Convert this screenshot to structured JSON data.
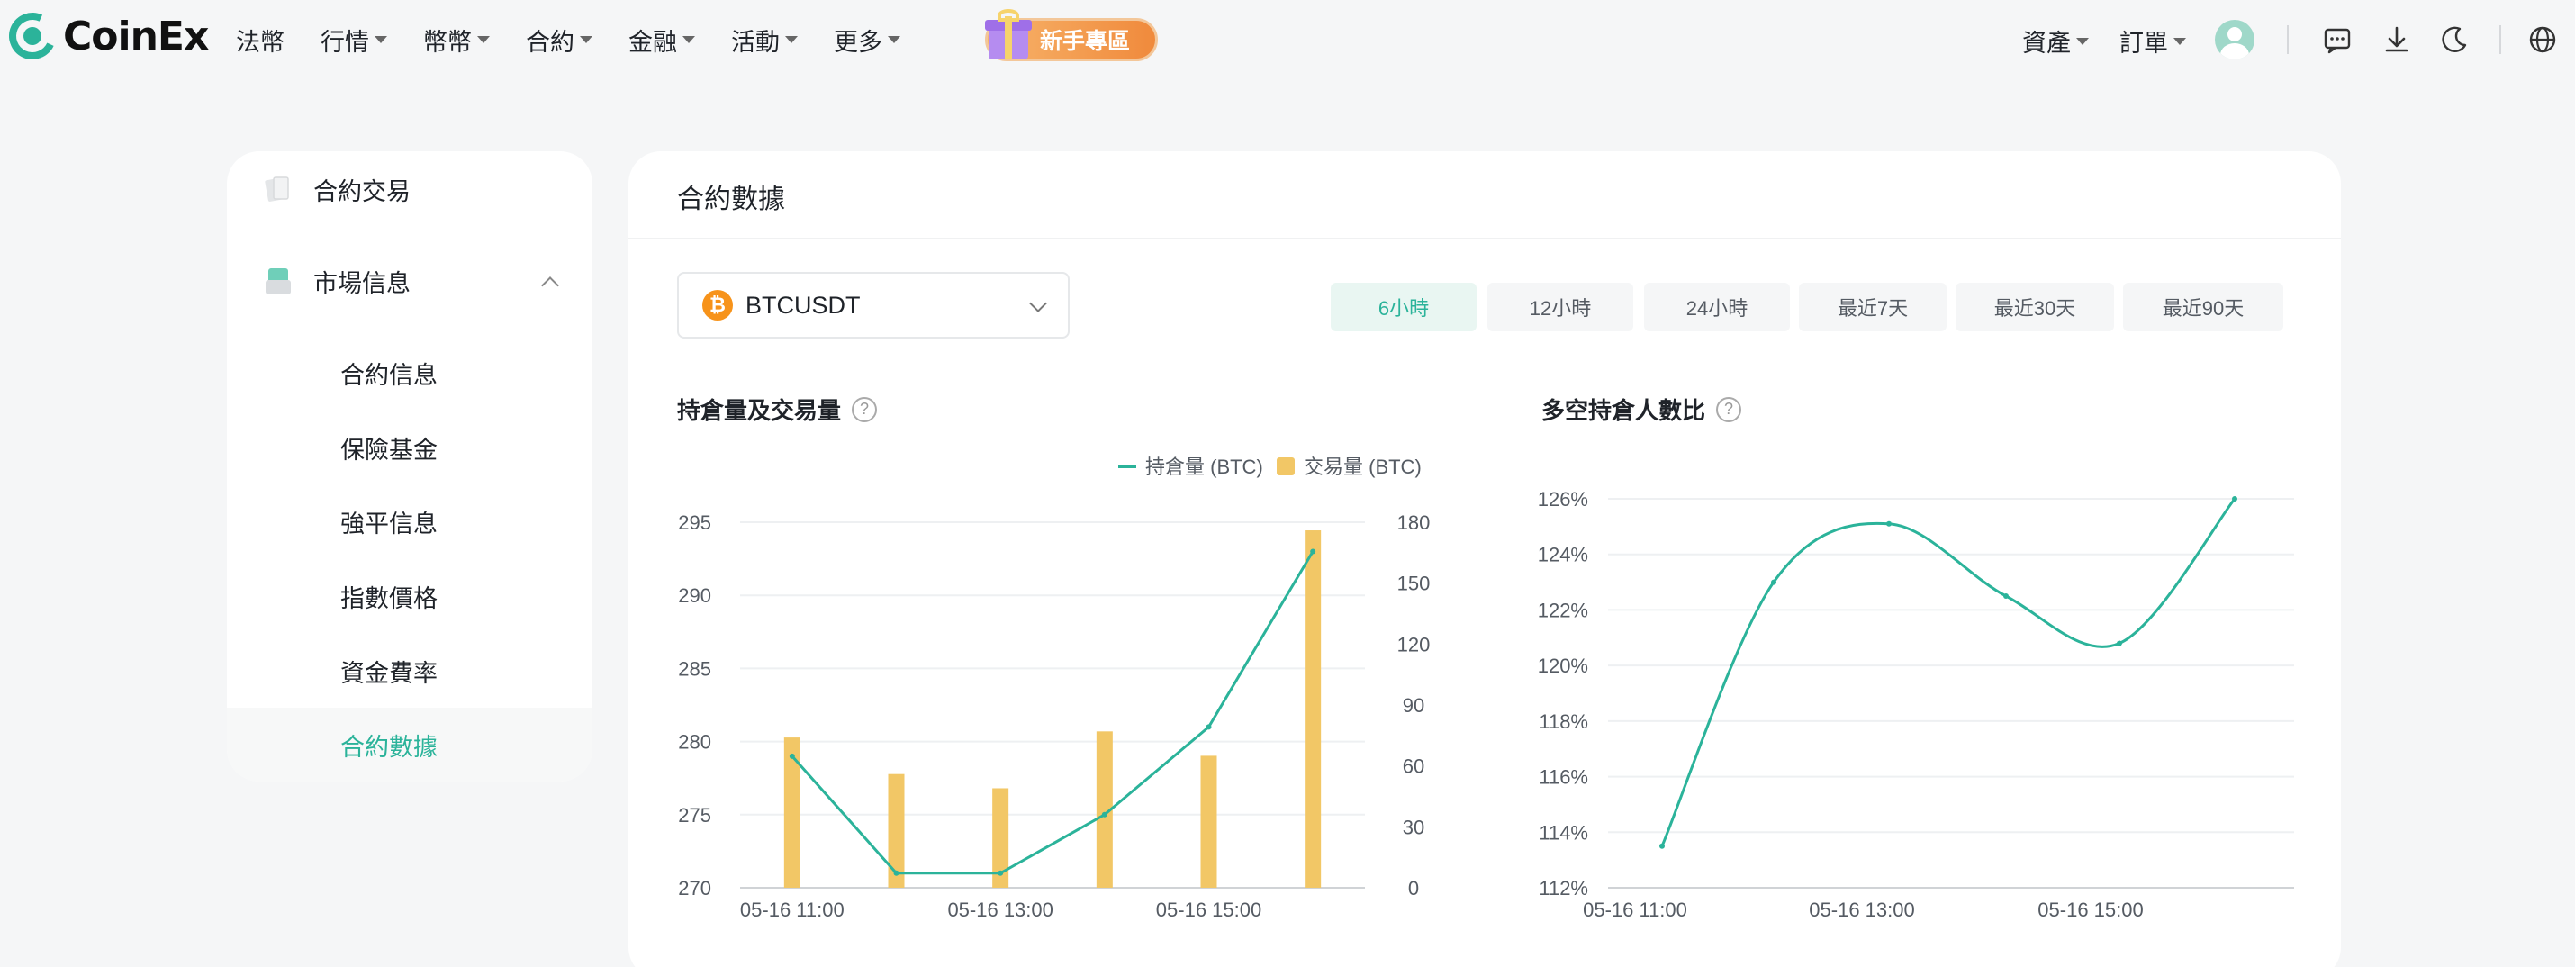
{
  "brand": {
    "name": "CoinEx"
  },
  "nav": {
    "items": [
      {
        "label": "法幣",
        "caret": false
      },
      {
        "label": "行情",
        "caret": true
      },
      {
        "label": "幣幣",
        "caret": true
      },
      {
        "label": "合約",
        "caret": true
      },
      {
        "label": "金融",
        "caret": true
      },
      {
        "label": "活動",
        "caret": true
      },
      {
        "label": "更多",
        "caret": true
      }
    ],
    "promo": "新手專區",
    "assets": "資產",
    "orders": "訂單"
  },
  "sidebar": {
    "sections": [
      {
        "label": "合約交易",
        "icon": "cards-icon"
      },
      {
        "label": "市場信息",
        "icon": "market-icon",
        "expanded": true
      }
    ],
    "items": [
      {
        "label": "合約信息"
      },
      {
        "label": "保險基金"
      },
      {
        "label": "強平信息"
      },
      {
        "label": "指數價格"
      },
      {
        "label": "資金費率"
      },
      {
        "label": "合約數據",
        "active": true
      }
    ]
  },
  "main": {
    "title": "合約數據",
    "pair": {
      "symbol": "BTCUSDT",
      "coin": "₿"
    },
    "ranges": [
      {
        "label": "6小時",
        "active": true
      },
      {
        "label": "12小時"
      },
      {
        "label": "24小時"
      },
      {
        "label": "最近7天"
      },
      {
        "label": "最近30天"
      },
      {
        "label": "最近90天"
      }
    ],
    "panel_left_title": "持倉量及交易量",
    "panel_right_title": "多空持倉人數比",
    "help": "?"
  },
  "colors": {
    "accent": "#2bb39a",
    "bar": "#f2c766",
    "promo": "#f08a3c"
  },
  "chart_data": [
    {
      "type": "bar+line",
      "title": "持倉量及交易量",
      "x_tick_labels": [
        "05-16  11:00",
        "05-16  13:00",
        "05-16  15:00"
      ],
      "legend": [
        "持倉量 (BTC)",
        "交易量 (BTC)"
      ],
      "left_axis": {
        "ticks": [
          270,
          275,
          280,
          285,
          290,
          295
        ],
        "range": [
          270,
          295
        ]
      },
      "right_axis": {
        "ticks": [
          0,
          30,
          60,
          90,
          120,
          150,
          180
        ],
        "range": [
          0,
          180
        ]
      },
      "series": [
        {
          "name": "持倉量 (BTC)",
          "kind": "line",
          "axis": "left",
          "values": [
            279,
            271,
            271,
            275,
            281,
            293
          ]
        },
        {
          "name": "交易量 (BTC)",
          "kind": "bar",
          "axis": "right",
          "values": [
            74,
            56,
            49,
            77,
            65,
            176
          ]
        }
      ]
    },
    {
      "type": "line",
      "title": "多空持倉人數比",
      "x_tick_labels": [
        "05-16  11:00",
        "05-16  13:00",
        "05-16  15:00"
      ],
      "y_axis": {
        "ticks": [
          "112%",
          "114%",
          "116%",
          "118%",
          "120%",
          "122%",
          "124%",
          "126%"
        ],
        "range": [
          112,
          126
        ]
      },
      "series": [
        {
          "name": "多空持倉人數比",
          "values": [
            113.5,
            123.0,
            125.1,
            122.5,
            120.8,
            126.0
          ]
        }
      ]
    }
  ]
}
